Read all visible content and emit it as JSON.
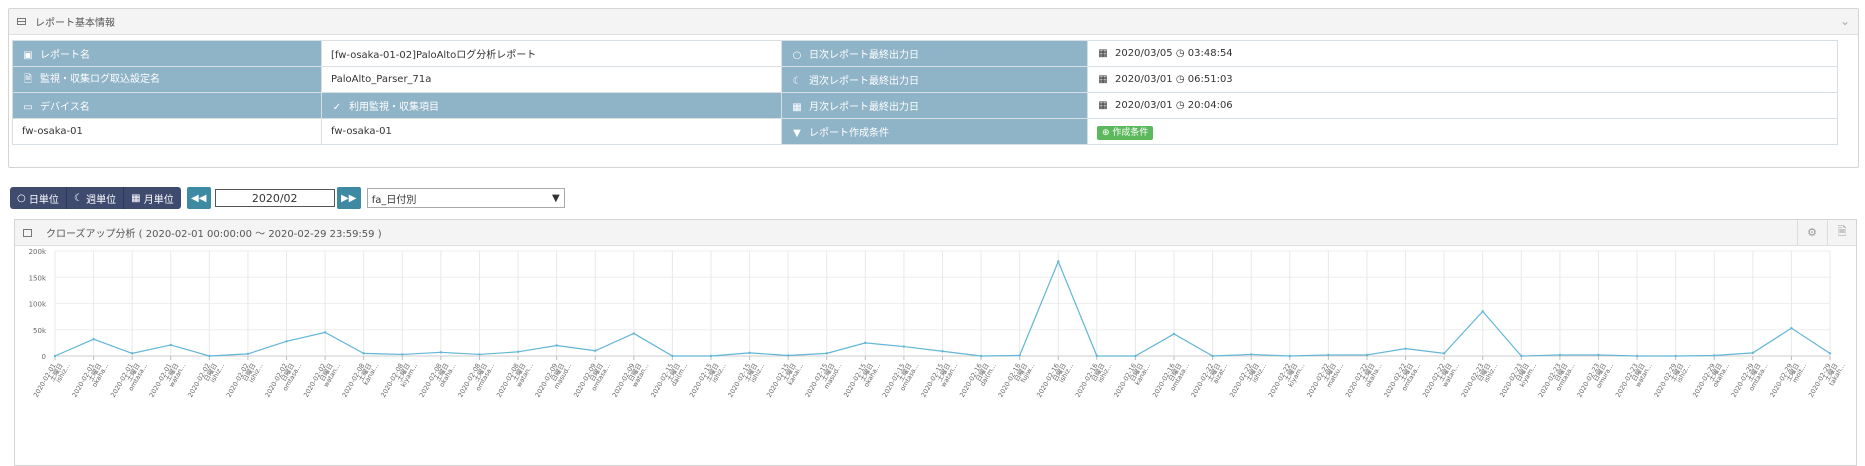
{
  "report_panel": {
    "title": "レポート基本情報"
  },
  "info_rows": [
    {
      "label1": "レポート名",
      "icon1": "image-icon",
      "value1": "[fw-osaka-01-02]PaloAltoログ分析レポート",
      "label2": "日次レポート最終出力日",
      "icon2": "circle-icon",
      "value2_date": "2020/03/05",
      "value2_time": "03:48:54"
    },
    {
      "label1": "監視・収集ログ取込設定名",
      "icon1": "file-icon",
      "value1": "PaloAlto_Parser_71a",
      "label2": "週次レポート最終出力日",
      "icon2": "moon-icon",
      "value2_date": "2020/03/01",
      "value2_time": "06:51:03"
    },
    {
      "label1": "デバイス名",
      "icon1": "monitor-icon",
      "label1b": "利用監視・収集項目",
      "icon1b": "bolt-icon",
      "label2": "月次レポート最終出力日",
      "icon2": "calendar-icon",
      "value2_date": "2020/03/01",
      "value2_time": "20:04:06"
    }
  ],
  "device_row": {
    "device": "fw-osaka-01",
    "item": "fw-osaka-01",
    "label": "レポート作成条件",
    "badge": "作成条件"
  },
  "toolbar": {
    "daily": "日単位",
    "weekly": "週単位",
    "monthly": "月単位",
    "month": "2020/02",
    "select": "fa_日付別"
  },
  "closeup": {
    "title": "クローズアップ分析 ( 2020-02-01 00:00:00 〜 2020-02-29 23:59:59 )"
  },
  "chart_data": {
    "type": "line",
    "y_ticks": [
      "0",
      "50k",
      "100k",
      "150k",
      "200k"
    ],
    "ylim": [
      0,
      200000
    ],
    "line_color": "#62b6d6",
    "categories": [
      [
        "2020-02-01",
        "土曜日",
        "ishiz..."
      ],
      [
        "2020-02-01",
        "土曜日",
        "okaha..."
      ],
      [
        "2020-02-01",
        "土曜日",
        "omtasa..."
      ],
      [
        "2020-02-01",
        "土曜日",
        "watan..."
      ],
      [
        "2020-02-02",
        "日曜日",
        "ishiz..."
      ],
      [
        "2020-02-02",
        "日曜日",
        "ishiz..."
      ],
      [
        "2020-02-02",
        "日曜日",
        "omtasa..."
      ],
      [
        "2020-02-02",
        "日曜日",
        "watan..."
      ],
      [
        "2020-02-08",
        "土曜日",
        "kanai..."
      ],
      [
        "2020-02-08",
        "土曜日",
        "kiyam..."
      ],
      [
        "2020-02-08",
        "土曜日",
        "okaha..."
      ],
      [
        "2020-02-08",
        "土曜日",
        "omtasa..."
      ],
      [
        "2020-02-08",
        "土曜日",
        "watan..."
      ],
      [
        "2020-02-09",
        "日曜日",
        "masud..."
      ],
      [
        "2020-02-09",
        "日曜日",
        "omtasa..."
      ],
      [
        "2020-02-09",
        "日曜日",
        "watan..."
      ],
      [
        "2020-02-15",
        "土曜日",
        "dai(m..."
      ],
      [
        "2020-02-15",
        "土曜日",
        "ishiz..."
      ],
      [
        "2020-02-15",
        "土曜日",
        "ishiz..."
      ],
      [
        "2020-02-15",
        "土曜日",
        "kanai..."
      ],
      [
        "2020-02-15",
        "土曜日",
        "masud..."
      ],
      [
        "2020-02-15",
        "土曜日",
        "okaha..."
      ],
      [
        "2020-02-15",
        "土曜日",
        "omtasa..."
      ],
      [
        "2020-02-15",
        "土曜日",
        "watan..."
      ],
      [
        "2020-02-16",
        "日曜日",
        "dai(m..."
      ],
      [
        "2020-02-16",
        "日曜日",
        "fujiw..."
      ],
      [
        "2020-02-16",
        "日曜日",
        "ishiz..."
      ],
      [
        "2020-02-16",
        "日曜日",
        "ishiz..."
      ],
      [
        "2020-02-16",
        "日曜日",
        "kanai..."
      ],
      [
        "2020-02-16",
        "日曜日",
        "omtasa..."
      ],
      [
        "2020-02-22",
        "土曜日",
        "aizat..."
      ],
      [
        "2020-02-22",
        "土曜日",
        "ishiz..."
      ],
      [
        "2020-02-22",
        "土曜日",
        "kiyam..."
      ],
      [
        "2020-02-22",
        "土曜日",
        "matsu..."
      ],
      [
        "2020-02-22",
        "土曜日",
        "okaha..."
      ],
      [
        "2020-02-22",
        "土曜日",
        "omtasa..."
      ],
      [
        "2020-02-22",
        "土曜日",
        "watan..."
      ],
      [
        "2020-02-23",
        "日曜日",
        "ishiz..."
      ],
      [
        "2020-02-23",
        "日曜日",
        "kiyam..."
      ],
      [
        "2020-02-23",
        "日曜日",
        "omtasa..."
      ],
      [
        "2020-02-23",
        "日曜日",
        "omura..."
      ],
      [
        "2020-02-23",
        "日曜日",
        "watan..."
      ],
      [
        "2020-02-29",
        "土曜日",
        "ishiz..."
      ],
      [
        "2020-02-29",
        "土曜日",
        "okaha..."
      ],
      [
        "2020-02-29",
        "土曜日",
        "omtasa..."
      ],
      [
        "2020-02-29",
        "土曜日",
        "moit..."
      ],
      [
        "2020-02-29",
        "土曜日",
        "takah..."
      ]
    ],
    "values": [
      0,
      32000,
      5000,
      21000,
      0,
      4000,
      28000,
      45000,
      5000,
      3000,
      7000,
      3000,
      8000,
      20000,
      10000,
      43000,
      0,
      0,
      6000,
      1000,
      5000,
      25000,
      18000,
      9000,
      0,
      1000,
      180000,
      0,
      0,
      42000,
      0,
      3000,
      0,
      2000,
      2000,
      14000,
      5000,
      85000,
      0,
      2000,
      2000,
      0,
      0,
      1000,
      6000,
      53000,
      5000
    ]
  }
}
